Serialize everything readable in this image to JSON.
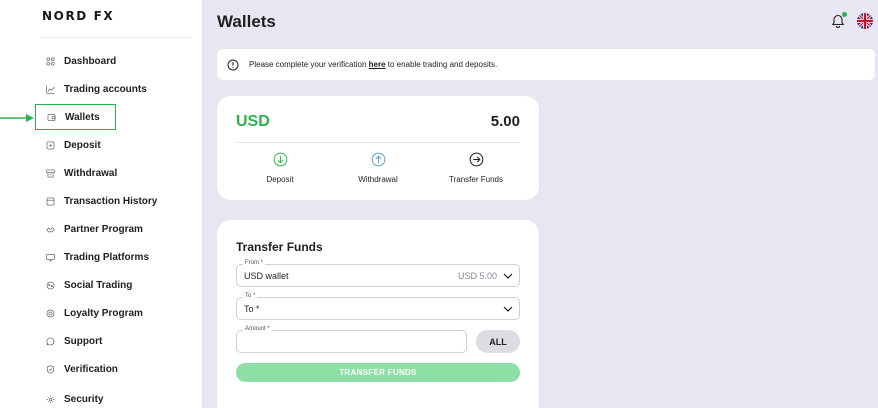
{
  "brand": {
    "logo_text": "NORD FX"
  },
  "sidebar": {
    "items": [
      {
        "label": "Dashboard",
        "icon": "dashboard-icon"
      },
      {
        "label": "Trading accounts",
        "icon": "chart-icon"
      },
      {
        "label": "Wallets",
        "icon": "wallet-icon",
        "active": true
      },
      {
        "label": "Deposit",
        "icon": "deposit-icon"
      },
      {
        "label": "Withdrawal",
        "icon": "withdrawal-icon"
      },
      {
        "label": "Transaction History",
        "icon": "history-icon"
      },
      {
        "label": "Partner Program",
        "icon": "partner-icon"
      },
      {
        "label": "Trading Platforms",
        "icon": "platforms-icon"
      },
      {
        "label": "Social Trading",
        "icon": "social-icon"
      },
      {
        "label": "Loyalty Program",
        "icon": "loyalty-icon"
      },
      {
        "label": "Support",
        "icon": "support-icon"
      },
      {
        "label": "Verification",
        "icon": "shield-icon"
      },
      {
        "label": "Security",
        "icon": "gear-icon"
      }
    ]
  },
  "header": {
    "title": "Wallets"
  },
  "notice": {
    "before": "Please complete your verification ",
    "link": "here",
    "after": " to enable trading and deposits."
  },
  "wallet": {
    "currency": "USD",
    "balance": "5.00",
    "actions": [
      {
        "label": "Deposit",
        "icon": "arrow-down-circle-icon"
      },
      {
        "label": "Withdrawal",
        "icon": "arrow-up-circle-icon"
      },
      {
        "label": "Transfer Funds",
        "icon": "arrow-right-circle-icon"
      }
    ]
  },
  "transfer": {
    "title": "Transfer Funds",
    "from_label": "From *",
    "from_value": "USD wallet",
    "from_balance": "USD 5.00",
    "to_label": "To *",
    "to_value": "To *",
    "amount_label": "Amount *",
    "amount_value": "",
    "all_label": "ALL",
    "submit_label": "TRANSFER FUNDS"
  },
  "colors": {
    "accent": "#2bb24c",
    "background": "#e8e6f3",
    "button_disabled": "#8ddfa5"
  }
}
